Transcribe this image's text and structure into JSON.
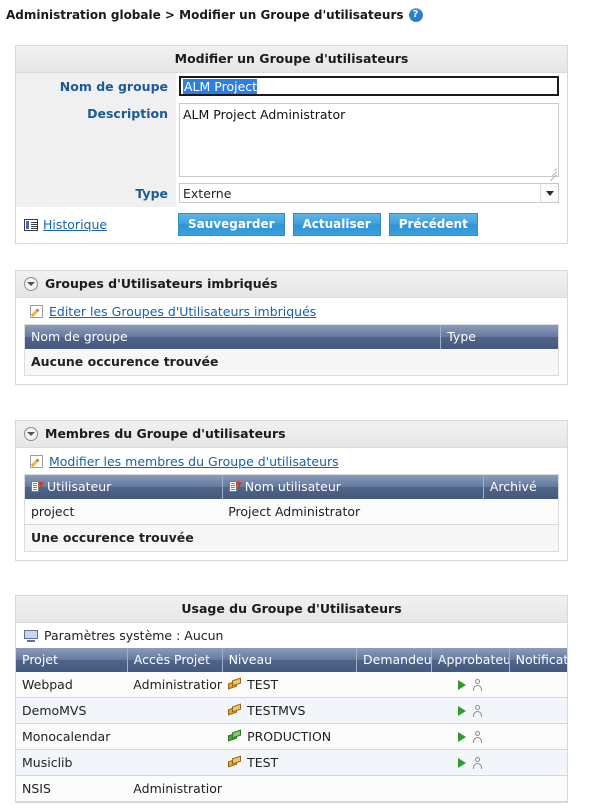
{
  "breadcrumb": {
    "text": "Administration globale > Modifier un Groupe d'utilisateurs",
    "help_icon": "help-circle-icon",
    "help_label": "?"
  },
  "form_panel": {
    "title": "Modifier un Groupe d'utilisateurs",
    "fields": {
      "name_label": "Nom de groupe",
      "name_value": "ALM Project",
      "name_selected": true,
      "description_label": "Description",
      "description_value": "ALM Project Administrator",
      "type_label": "Type",
      "type_value": "Externe",
      "type_options": [
        "Externe"
      ]
    },
    "history_link": "Historique",
    "history_icon": "history-table-icon",
    "buttons": [
      {
        "label": "Sauvegarder",
        "name": "save-button"
      },
      {
        "label": "Actualiser",
        "name": "refresh-button"
      },
      {
        "label": "Précédent",
        "name": "back-button"
      }
    ],
    "button_color": "#3a9fd9"
  },
  "nested_groups": {
    "section_title": "Groupes d'Utilisateurs imbriqués",
    "edit_link": "Editer les Groupes d'Utilisateurs imbriqués",
    "edit_icon": "pencil-edit-icon",
    "columns": [
      "Nom de groupe",
      "Type"
    ],
    "rows": [],
    "footer": "Aucune occurence trouvée"
  },
  "members": {
    "section_title": "Membres du Groupe d'utilisateurs",
    "edit_link": "Modifier les membres du Groupe d'utilisateurs",
    "edit_icon": "pencil-edit-icon",
    "columns": [
      "Utilisateur",
      "Nom utilisateur",
      "Archivé"
    ],
    "sortable": [
      true,
      true,
      false
    ],
    "rows": [
      {
        "user": "project",
        "name": "Project Administrator",
        "archived": ""
      }
    ],
    "footer": "Une occurence trouvée"
  },
  "usage": {
    "title": "Usage du Groupe d'Utilisateurs",
    "system_settings_label": "Paramètres système : Aucun",
    "system_settings_icon": "monitor-icon",
    "columns": [
      "Projet",
      "Accès Projet",
      "Niveau",
      "Demandeur",
      "Approbateur",
      "Notification"
    ],
    "rows": [
      {
        "project": "Webpad",
        "access": "Administration",
        "level": "TEST",
        "level_color": "orange",
        "requester": "",
        "approver": true,
        "notification": ""
      },
      {
        "project": "DemoMVS",
        "access": "",
        "level": "TESTMVS",
        "level_color": "orange",
        "requester": "",
        "approver": true,
        "notification": ""
      },
      {
        "project": "Monocalendar",
        "access": "",
        "level": "PRODUCTION",
        "level_color": "green",
        "requester": "",
        "approver": true,
        "notification": ""
      },
      {
        "project": "Musiclib",
        "access": "",
        "level": "TEST",
        "level_color": "orange",
        "requester": "",
        "approver": true,
        "notification": ""
      },
      {
        "project": "NSIS",
        "access": "Administration",
        "level": "",
        "level_color": "",
        "requester": "",
        "approver": false,
        "notification": ""
      }
    ]
  },
  "colors": {
    "accent_blue": "#1763a8",
    "table_header": "#5d7299",
    "button_blue": "#3a9fd9",
    "label_blue": "#1c5a96",
    "selection_blue": "#2a7fe0"
  }
}
